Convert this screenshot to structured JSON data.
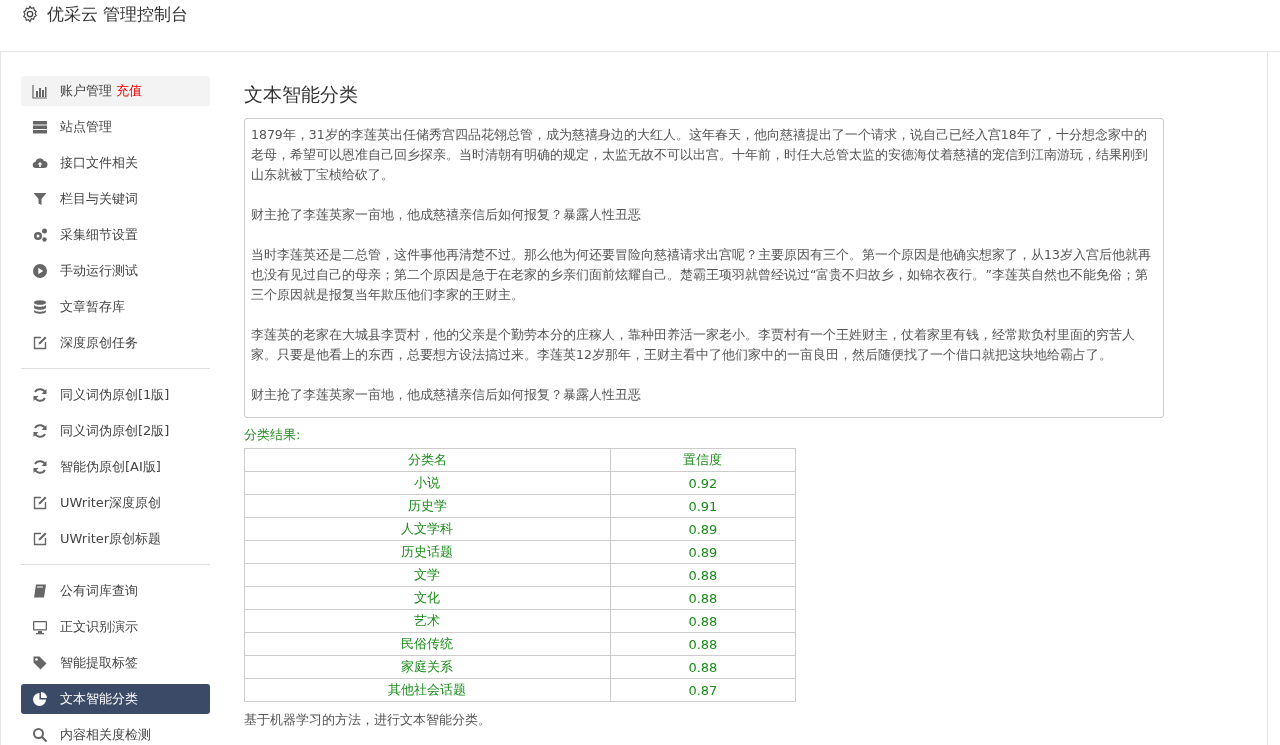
{
  "header": {
    "title": "优采云 管理控制台"
  },
  "sidebar": {
    "groups": [
      {
        "items": [
          {
            "label": "账户管理",
            "badge": "充值",
            "selected": false,
            "highlighted": true
          },
          {
            "label": "站点管理",
            "selected": false,
            "highlighted": false
          },
          {
            "label": "接口文件相关",
            "selected": false,
            "highlighted": false
          },
          {
            "label": "栏目与关键词",
            "selected": false,
            "highlighted": false
          },
          {
            "label": "采集细节设置",
            "selected": false,
            "highlighted": false
          },
          {
            "label": "手动运行测试",
            "selected": false,
            "highlighted": false
          },
          {
            "label": "文章暂存库",
            "selected": false,
            "highlighted": false
          },
          {
            "label": "深度原创任务",
            "selected": false,
            "highlighted": false
          }
        ]
      },
      {
        "items": [
          {
            "label": "同义词伪原创[1版]",
            "selected": false,
            "highlighted": false
          },
          {
            "label": "同义词伪原创[2版]",
            "selected": false,
            "highlighted": false
          },
          {
            "label": "智能伪原创[AI版]",
            "selected": false,
            "highlighted": false
          },
          {
            "label": "UWriter深度原创",
            "selected": false,
            "highlighted": false
          },
          {
            "label": "UWriter原创标题",
            "selected": false,
            "highlighted": false
          }
        ]
      },
      {
        "items": [
          {
            "label": "公有词库查询",
            "selected": false,
            "highlighted": false
          },
          {
            "label": "正文识别演示",
            "selected": false,
            "highlighted": false
          },
          {
            "label": "智能提取标签",
            "selected": false,
            "highlighted": false
          },
          {
            "label": "文本智能分类",
            "selected": true,
            "highlighted": false
          },
          {
            "label": "内容相关度检测",
            "selected": false,
            "highlighted": false
          }
        ]
      }
    ]
  },
  "main": {
    "title": "文本智能分类",
    "article": {
      "paragraphs": [
        "1879年，31岁的李莲英出任储秀宫四品花翎总管，成为慈禧身边的大红人。这年春天，他向慈禧提出了一个请求，说自己已经入宫18年了，十分想念家中的老母，希望可以恩准自己回乡探亲。当时清朝有明确的规定，太监无故不可以出宫。十年前，时任大总管太监的安德海仗着慈禧的宠信到江南游玩，结果刚到山东就被丁宝桢给砍了。",
        "财主抢了李莲英家一亩地，他成慈禧亲信后如何报复？暴露人性丑恶",
        "当时李莲英还是二总管，这件事他再清楚不过。那么他为何还要冒险向慈禧请求出宫呢？主要原因有三个。第一个原因是他确实想家了，从13岁入宫后他就再也没有见过自己的母亲；第二个原因是急于在老家的乡亲们面前炫耀自己。楚霸王项羽就曾经说过“富贵不归故乡，如锦衣夜行。”李莲英自然也不能免俗；第三个原因就是报复当年欺压他们李家的王财主。",
        "李莲英的老家在大城县李贾村，他的父亲是个勤劳本分的庄稼人，靠种田养活一家老小。李贾村有一个王姓财主，仗着家里有钱，经常欺负村里面的穷苦人家。只要是他看上的东西，总要想方设法搞过来。李莲英12岁那年，王财主看中了他们家中的一亩良田，然后随便找了一个借口就把这块地给霸占了。",
        "财主抢了李莲英家一亩地，他成慈禧亲信后如何报复？暴露人性丑恶"
      ]
    },
    "result_label": "分类结果:",
    "table": {
      "columns": [
        "分类名",
        "置信度"
      ],
      "rows": [
        [
          "小说",
          "0.92"
        ],
        [
          "历史学",
          "0.91"
        ],
        [
          "人文学科",
          "0.89"
        ],
        [
          "历史话题",
          "0.89"
        ],
        [
          "文学",
          "0.88"
        ],
        [
          "文化",
          "0.88"
        ],
        [
          "艺术",
          "0.88"
        ],
        [
          "民俗传统",
          "0.88"
        ],
        [
          "家庭关系",
          "0.88"
        ],
        [
          "其他社会话题",
          "0.87"
        ]
      ]
    },
    "description": "基于机器学习的方法，进行文本智能分类。"
  }
}
